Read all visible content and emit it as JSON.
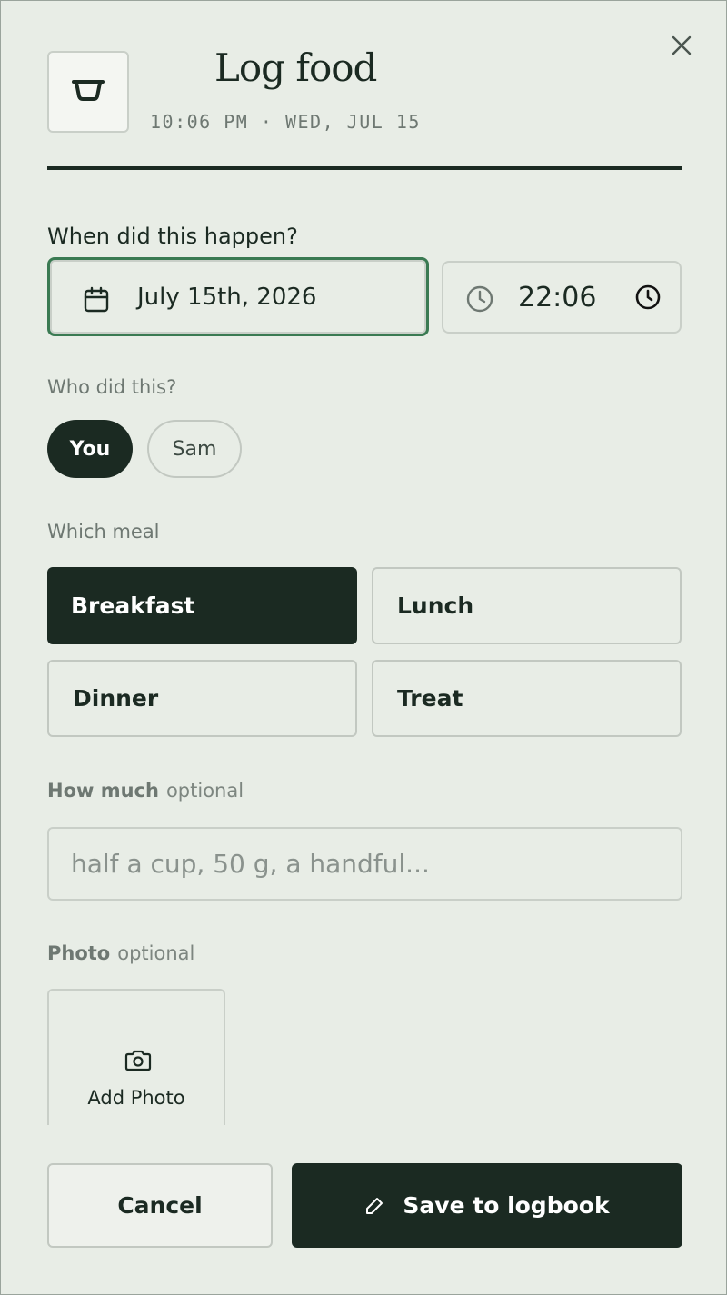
{
  "header": {
    "title": "Log food",
    "subtitle": "10:06 PM · WED, JUL 15",
    "icon": "bowl-icon",
    "close_icon": "close-icon"
  },
  "when": {
    "label": "When did this happen?",
    "date_value": "July 15th, 2026",
    "date_icon": "calendar-icon",
    "time_value": "22:06",
    "time_icon_left": "clock-icon",
    "time_icon_right": "clock-picker-icon"
  },
  "who": {
    "label": "Who did this?",
    "options": [
      {
        "label": "You",
        "selected": true
      },
      {
        "label": "Sam",
        "selected": false
      }
    ]
  },
  "meal": {
    "label": "Which meal",
    "options": [
      {
        "label": "Breakfast",
        "selected": true
      },
      {
        "label": "Lunch",
        "selected": false
      },
      {
        "label": "Dinner",
        "selected": false
      },
      {
        "label": "Treat",
        "selected": false
      }
    ]
  },
  "amount": {
    "label": "How much",
    "optional": "optional",
    "placeholder": "half a cup, 50 g, a handful..."
  },
  "photo": {
    "label": "Photo",
    "optional": "optional",
    "add_label": "Add Photo",
    "icon": "camera-icon"
  },
  "actions": {
    "cancel": "Cancel",
    "save": "Save to logbook",
    "save_icon": "pencil-icon"
  },
  "colors": {
    "background": "#e8ede6",
    "primary": "#1b2a22",
    "focus_ring": "#3a7a52",
    "muted_text": "#6e7872"
  }
}
